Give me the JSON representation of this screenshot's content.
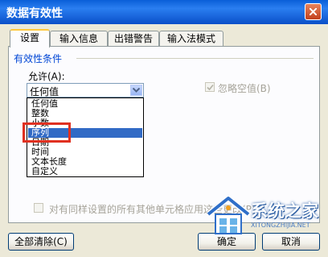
{
  "window": {
    "title": "数据有效性"
  },
  "tabs": [
    {
      "label": "设置"
    },
    {
      "label": "输入信息"
    },
    {
      "label": "出错警告"
    },
    {
      "label": "输入法模式"
    }
  ],
  "settings": {
    "group_title": "有效性条件",
    "allow_label": "允许(A):",
    "allow_selected": "任何值",
    "allow_options": [
      "任何值",
      "整数",
      "小数",
      "序列",
      "日期",
      "时间",
      "文本长度",
      "自定义"
    ],
    "highlighted_option": "序列",
    "ignore_blank_label": "忽略空值(B)",
    "ignore_blank_checked": true,
    "apply_all_label": "对有同样设置的所有其他单元格应用这些更改(P)",
    "apply_all_checked": false
  },
  "buttons": {
    "clear_all": "全部清除(C)",
    "ok": "确定",
    "cancel": "取消"
  },
  "watermark": {
    "logo_text": "系统之家",
    "url_text": "XITONGZHIJIA.NET"
  },
  "colors": {
    "title_bar": "#0a5fd8",
    "selection": "#316ac5",
    "highlight_box": "#e03020",
    "group_title": "#0046d5"
  }
}
